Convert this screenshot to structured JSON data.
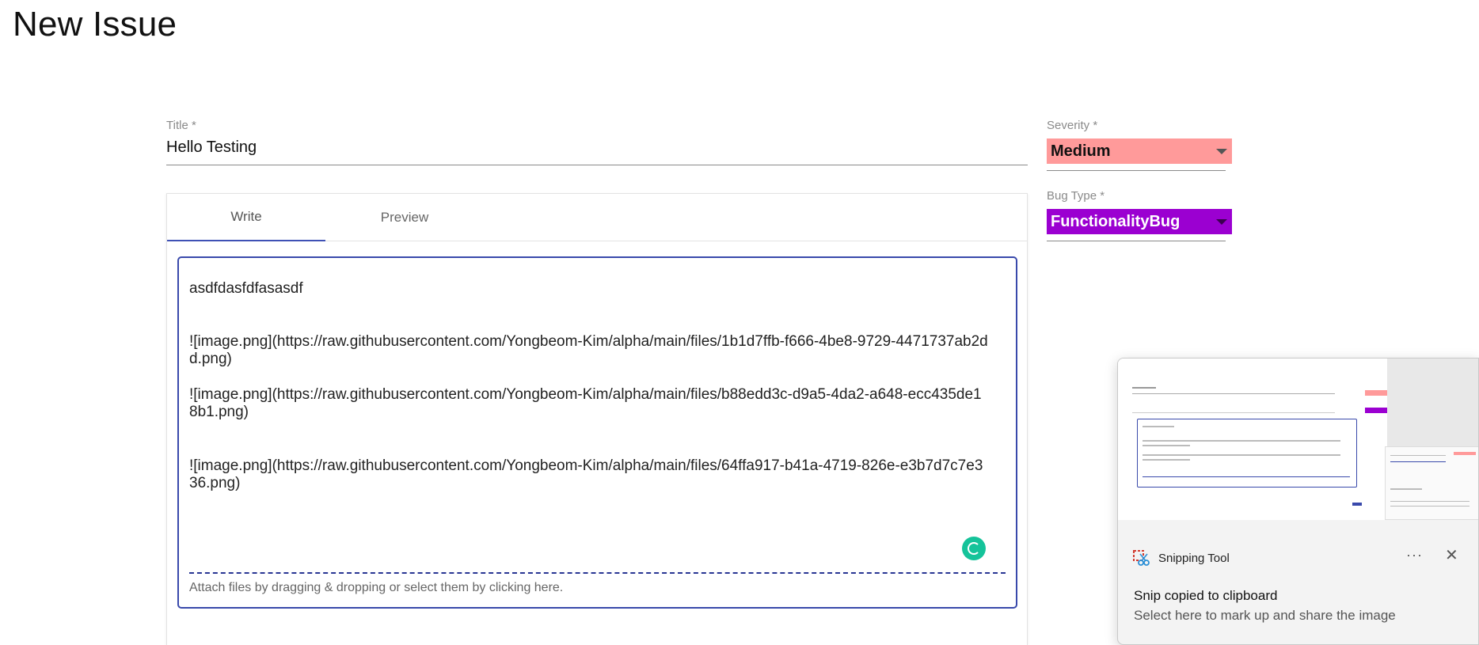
{
  "page": {
    "title": "New Issue"
  },
  "title_field": {
    "label": "Title *",
    "value": "Hello Testing"
  },
  "editor": {
    "tabs": [
      {
        "label": "Write",
        "active": true
      },
      {
        "label": "Preview",
        "active": false
      }
    ],
    "lines": [
      "asdfdasfdfasasdf",
      "![image.png](https://raw.githubusercontent.com/Yongbeom-Kim/alpha/main/files/1b1d7ffb-f666-4be8-9729-4471737ab2dd.png)",
      "![image.png](https://raw.githubusercontent.com/Yongbeom-Kim/alpha/main/files/b88edd3c-d9a5-4da2-a648-ecc435de18b1.png)",
      "![image.png](https://raw.githubusercontent.com/Yongbeom-Kim/alpha/main/files/64ffa917-b41a-4719-826e-e3b7d7c7e336.png)"
    ],
    "attach_hint": "Attach files by dragging & dropping or select them by clicking here."
  },
  "severity": {
    "label": "Severity *",
    "value": "Medium",
    "color": "#ff9a9a"
  },
  "bug_type": {
    "label": "Bug Type *",
    "value": "FunctionalityBug",
    "color": "#9b00d1"
  },
  "toast": {
    "app_name": "Snipping Tool",
    "title": "Snip copied to clipboard",
    "subtitle": "Select here to mark up and share the image",
    "more_icon": "ellipsis-icon",
    "close_icon": "close-icon"
  },
  "colors": {
    "accent": "#3949ab",
    "grammarly": "#15c39a"
  }
}
